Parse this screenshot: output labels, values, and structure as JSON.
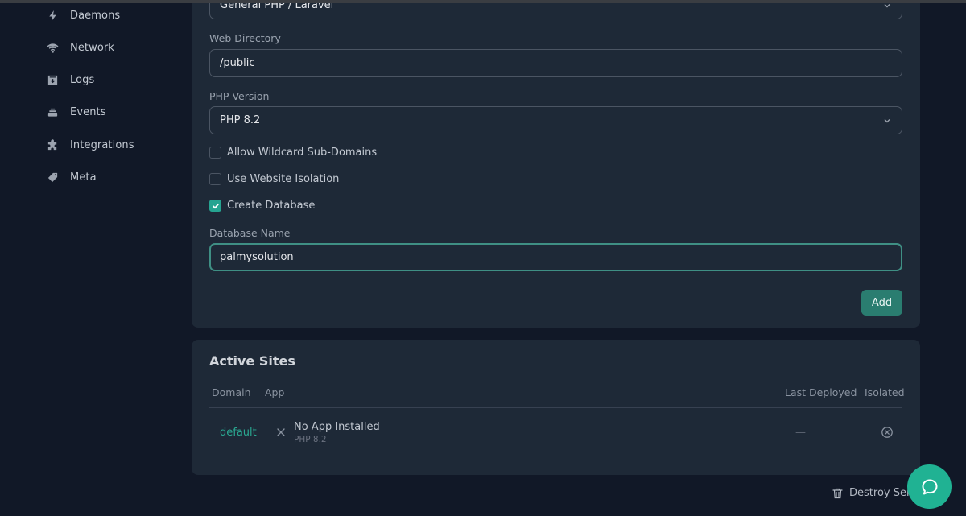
{
  "sidebar": {
    "items": [
      {
        "label": "Daemons",
        "icon": "bolt-icon"
      },
      {
        "label": "Network",
        "icon": "wifi-icon"
      },
      {
        "label": "Logs",
        "icon": "archive-icon"
      },
      {
        "label": "Events",
        "icon": "layers-icon"
      },
      {
        "label": "Integrations",
        "icon": "puzzle-icon"
      },
      {
        "label": "Meta",
        "icon": "tag-icon"
      }
    ]
  },
  "form": {
    "project_type": {
      "value": "General PHP / Laravel"
    },
    "web_directory": {
      "label": "Web Directory",
      "value": "/public"
    },
    "php_version": {
      "label": "PHP Version",
      "value": "PHP 8.2"
    },
    "checkboxes": [
      {
        "label": "Allow Wildcard Sub-Domains",
        "checked": false
      },
      {
        "label": "Use Website Isolation",
        "checked": false
      },
      {
        "label": "Create Database",
        "checked": true
      }
    ],
    "database_name": {
      "label": "Database Name",
      "value": "palmysolution"
    },
    "add_label": "Add"
  },
  "active_sites": {
    "title": "Active Sites",
    "columns": [
      "Domain",
      "App",
      "Last Deployed",
      "Isolated"
    ],
    "rows": [
      {
        "domain": "default",
        "app_name": "No App Installed",
        "app_php": "PHP 8.2",
        "last_deployed": "—",
        "isolated": false
      }
    ]
  },
  "footer": {
    "destroy_label": "Destroy Server"
  },
  "colors": {
    "accent": "#26a491",
    "chat": "#20b293",
    "add_button": "#2a7d70",
    "background": "#111827",
    "card": "#1e2937"
  }
}
